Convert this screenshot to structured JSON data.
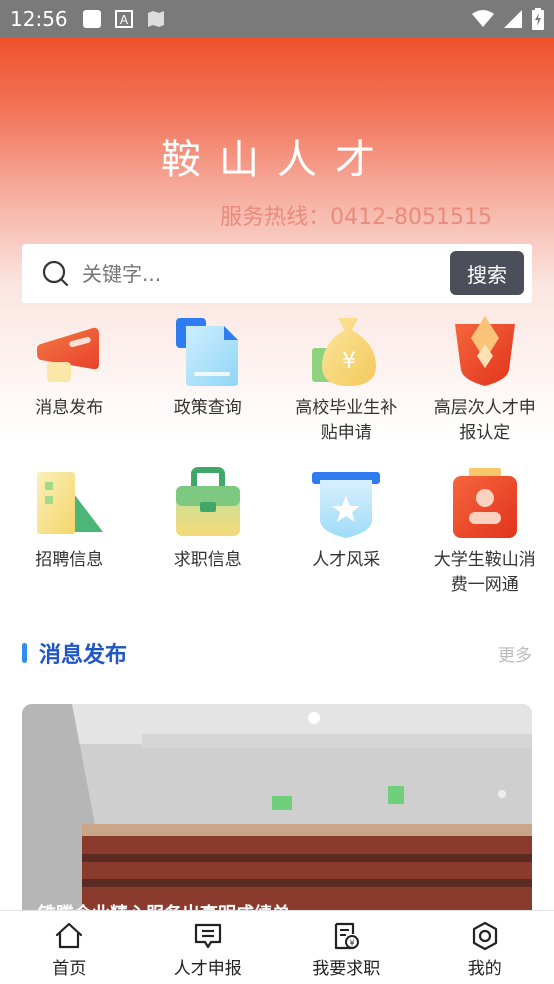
{
  "status_bar": {
    "time": "12:56"
  },
  "header": {
    "title": "鞍山人才",
    "hotline": "服务热线：0412-8051515"
  },
  "search": {
    "placeholder": "关键字...",
    "button_label": "搜索"
  },
  "grid": {
    "items": [
      {
        "label": "消息发布",
        "icon": "megaphone-icon"
      },
      {
        "label": "政策查询",
        "icon": "document-icon"
      },
      {
        "label": "高校毕业生补贴申请",
        "icon": "money-bag-icon"
      },
      {
        "label": "高层次人才申报认定",
        "icon": "badge-icon"
      },
      {
        "label": "招聘信息",
        "icon": "building-icon"
      },
      {
        "label": "求职信息",
        "icon": "briefcase-icon"
      },
      {
        "label": "人才风采",
        "icon": "star-shield-icon"
      },
      {
        "label": "大学生鞍山消费一网通",
        "icon": "id-card-icon"
      }
    ]
  },
  "section": {
    "title": "消息发布",
    "more": "更多"
  },
  "news": {
    "caption": "铁腾企业精心服务出高明成绩单"
  },
  "bottom_nav": {
    "items": [
      {
        "label": "首页",
        "icon": "home-icon"
      },
      {
        "label": "人才申报",
        "icon": "message-icon"
      },
      {
        "label": "我要求职",
        "icon": "resume-icon"
      },
      {
        "label": "我的",
        "icon": "settings-icon"
      }
    ]
  },
  "colors": {
    "header_top": "#f0512a",
    "search_button": "#4a4f5a",
    "section_title": "#1f55c5",
    "section_bar": "#2e8ef0"
  }
}
